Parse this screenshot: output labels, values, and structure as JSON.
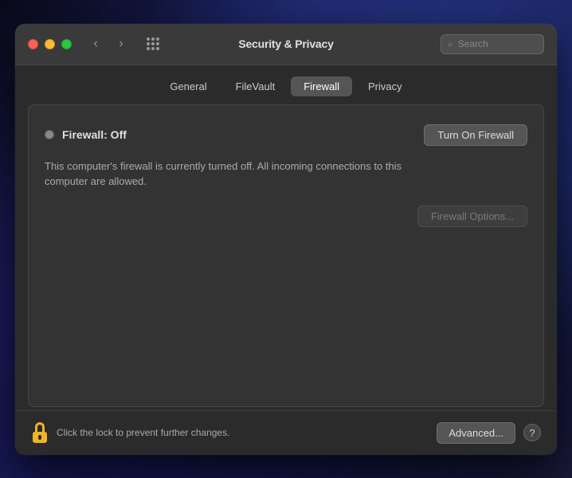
{
  "wallpaper": {},
  "window": {
    "title": "Security & Privacy",
    "search": {
      "placeholder": "Search"
    }
  },
  "titlebar": {
    "title": "Security & Privacy",
    "back_label": "‹",
    "forward_label": "›"
  },
  "tabs": {
    "items": [
      {
        "id": "general",
        "label": "General",
        "active": false
      },
      {
        "id": "filevault",
        "label": "FileVault",
        "active": false
      },
      {
        "id": "firewall",
        "label": "Firewall",
        "active": true
      },
      {
        "id": "privacy",
        "label": "Privacy",
        "active": false
      }
    ]
  },
  "firewall": {
    "status_dot_state": "off",
    "status_label": "Firewall: Off",
    "turn_on_label": "Turn On Firewall",
    "description": "This computer's firewall is currently turned off. All incoming connections to this computer are allowed.",
    "options_label": "Firewall Options..."
  },
  "bottom": {
    "lock_label": "Click the lock to prevent further changes.",
    "advanced_label": "Advanced...",
    "help_label": "?"
  }
}
